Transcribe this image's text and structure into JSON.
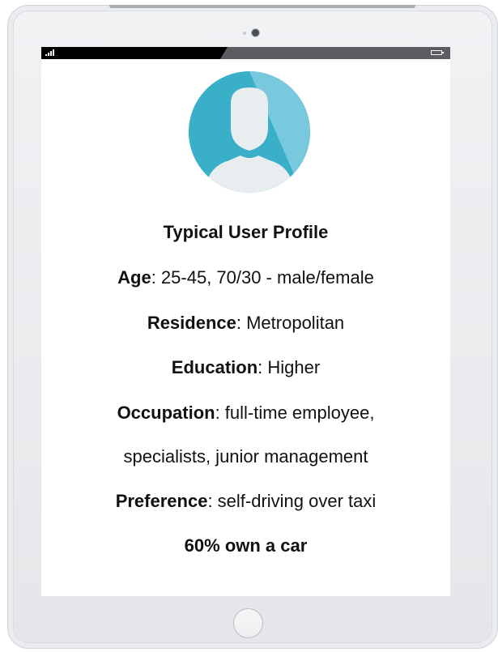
{
  "profile": {
    "title": "Typical User Profile",
    "age_label": "Age",
    "age_value": ": 25-45, 70/30 - male/female",
    "residence_label": "Residence",
    "residence_value": ": Metropolitan",
    "education_label": "Education",
    "education_value": ": Higher",
    "occupation_label": "Occupation",
    "occupation_value": ": full-time employee,",
    "occupation_value_2": "specialists, junior management",
    "preference_label": "Preference",
    "preference_value": ": self-driving over taxi",
    "car_ownership": "60% own a car"
  },
  "icons": {
    "avatar": "user-silhouette-icon",
    "signal": "signal-bars-icon",
    "battery": "battery-icon"
  },
  "colors": {
    "avatar_bg": "#3aafc8",
    "avatar_highlight": "#7fcce0",
    "silhouette": "#e8eef0",
    "status_bar": "#5b5d60"
  }
}
